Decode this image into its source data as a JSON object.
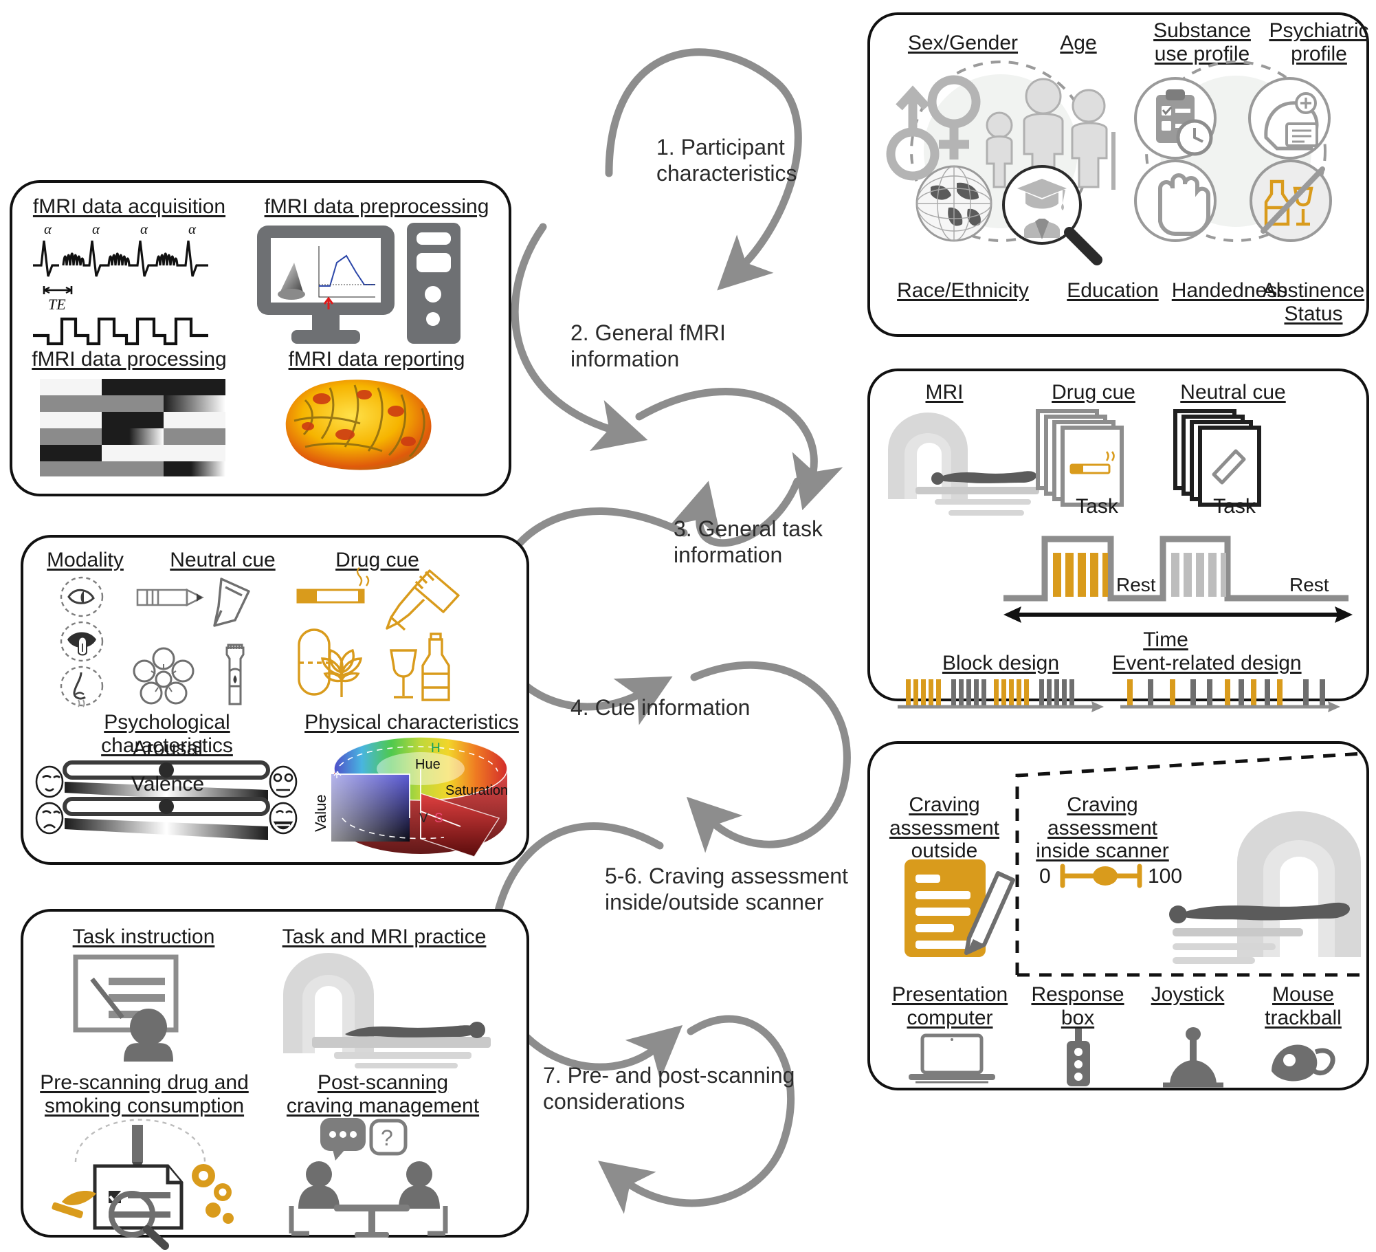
{
  "figure": {
    "type": "workflow-diagram",
    "title": "fMRI drug cue-reactivity study reporting checklist workflow",
    "accent_orange": "#d99b1c",
    "arrow_gray": "#8d8d8d",
    "ink": "#231f20"
  },
  "flow_steps": [
    {
      "id": 1,
      "label": "1. Participant\ncharacteristics"
    },
    {
      "id": 2,
      "label": "2. General fMRI\ninformation"
    },
    {
      "id": 3,
      "label": "3. General task\ninformation"
    },
    {
      "id": 4,
      "label": "4. Cue information"
    },
    {
      "id": 5,
      "label": "5-6. Craving assessment\ninside/outside scanner"
    },
    {
      "id": 7,
      "label": "7. Pre- and post-scanning\nconsiderations"
    }
  ],
  "panels": {
    "fmri": {
      "name": "fMRI panel",
      "headings": {
        "acquisition": "fMRI data acquisition",
        "preprocessing": "fMRI data preprocessing",
        "processing": "fMRI data processing",
        "reporting": "fMRI data reporting"
      },
      "acquisition_labels": {
        "alpha": "α",
        "te": "TE"
      },
      "alpha_count": 4
    },
    "cue": {
      "name": "Cue information panel",
      "headings": {
        "modality": "Modality",
        "neutral": "Neutral cue",
        "drug": "Drug cue",
        "psychological": "Psychological characteristics",
        "physical": "Physical characteristics"
      },
      "modality_icons": [
        "eye-icon",
        "mouth-tongue-icon",
        "nose-icon"
      ],
      "neutral_icons": [
        "pencil-icon",
        "pen-icon",
        "flower-icon",
        "water-bottle-icon"
      ],
      "drug_icons": [
        "cigarette-icon",
        "syringe-icon",
        "pill-cannabis-icon",
        "wine-bottle-icon"
      ],
      "scales": [
        "Arousal",
        "Valence"
      ],
      "color_space": {
        "hue_short": "H",
        "hue": "Hue",
        "saturation": "Saturation",
        "saturation_short": "S",
        "value": "Value",
        "value_short": "V"
      }
    },
    "prepost": {
      "name": "Pre- and post-scanning panel",
      "headings": {
        "instruction": "Task instruction",
        "practice": "Task and MRI practice",
        "prescanning": "Pre-scanning drug and\nsmoking consumption",
        "postscanning": "Post-scanning\ncraving management"
      }
    },
    "participants": {
      "name": "Participant characteristics panel",
      "headings_top": [
        "Sex/Gender",
        "Age",
        "Substance\nuse profile",
        "Psychiatric\nprofile"
      ],
      "headings_bottom": [
        "Race/Ethnicity",
        "Education",
        "Handedness",
        "Abstinence\nStatus"
      ],
      "icons": [
        "gender-symbols-icon",
        "age-figures-icon",
        "globe-icon",
        "graduation-magnifier-icon",
        "checklist-clock-icon",
        "head-record-icon",
        "hand-icon",
        "no-alcohol-icon"
      ]
    },
    "task": {
      "name": "General task information panel",
      "headings": {
        "mri": "MRI",
        "drug_cue": "Drug cue",
        "neutral_cue": "Neutral cue"
      },
      "timeline": {
        "task": "Task",
        "rest": "Rest",
        "time": "Time",
        "block_design": "Block design",
        "event_design": "Event-related design"
      },
      "plus_symbol": "+"
    },
    "craving": {
      "name": "Craving assessment panel",
      "headings": {
        "outside": "Craving assessment\noutside scanner",
        "inside": "Craving assessment\ninside scanner"
      },
      "vas": {
        "min": "0",
        "max": "100"
      },
      "devices": [
        {
          "label": "Presentation\ncomputer",
          "icon": "laptop-icon"
        },
        {
          "label": "Response\nbox",
          "icon": "response-box-icon"
        },
        {
          "label": "Joystick",
          "icon": "joystick-icon"
        },
        {
          "label": "Mouse\ntrackball",
          "icon": "mouse-trackball-icon"
        }
      ]
    }
  }
}
